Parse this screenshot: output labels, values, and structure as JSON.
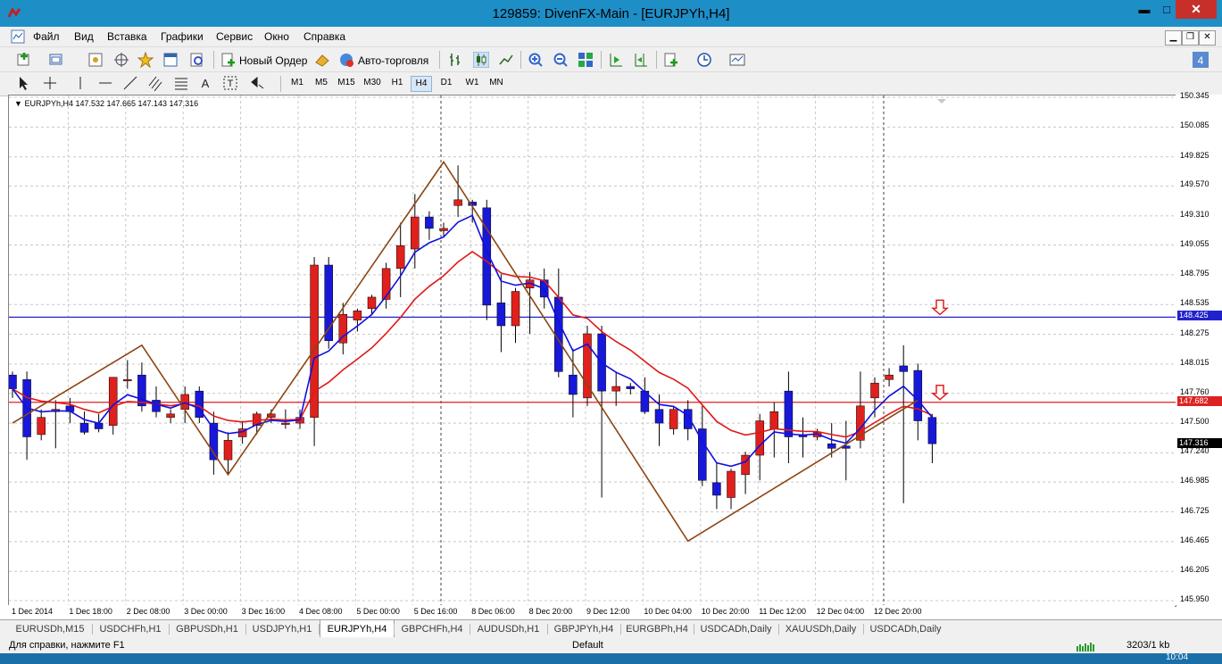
{
  "window": {
    "title": "129859: DivenFX-Main - [EURJPYh,H4]",
    "minimize": "▬",
    "maximize": "□",
    "close": "✕"
  },
  "menu": [
    "Файл",
    "Вид",
    "Вставка",
    "Графики",
    "Сервис",
    "Окно",
    "Справка"
  ],
  "toolbar": {
    "new_order": "Новый Ордер",
    "auto_trading": "Авто-торговля",
    "search_placeholder": ""
  },
  "timeframes": [
    "M1",
    "M5",
    "M15",
    "M30",
    "H1",
    "H4",
    "D1",
    "W1",
    "MN"
  ],
  "active_timeframe": "H4",
  "chart": {
    "header": "EURJPYh,H4  147.532 147.665 147.143 147.316",
    "price_ticks": [
      "150.345",
      "150.085",
      "149.825",
      "149.570",
      "149.310",
      "149.055",
      "148.795",
      "148.535",
      "148.275",
      "148.015",
      "147.760",
      "147.500",
      "147.240",
      "146.985",
      "146.725",
      "146.465",
      "146.205",
      "145.950"
    ],
    "time_ticks": [
      "1 Dec 2014",
      "1 Dec 18:00",
      "2 Dec 08:00",
      "3 Dec 00:00",
      "3 Dec 16:00",
      "4 Dec 08:00",
      "5 Dec 00:00",
      "5 Dec 16:00",
      "8 Dec 06:00",
      "8 Dec 20:00",
      "9 Dec 12:00",
      "10 Dec 04:00",
      "10 Dec 20:00",
      "11 Dec 12:00",
      "12 Dec 04:00",
      "12 Dec 20:00"
    ],
    "blue_line_label": "148.425",
    "red_line_label": "147.682",
    "current_price_label": "147.316",
    "colors": {
      "bull": "#e0201c",
      "bear": "#1818d8",
      "zigzag": "#8b4513",
      "fast_ma": "#1010e0",
      "slow_ma": "#e01818"
    }
  },
  "chart_data": {
    "type": "candlestick",
    "symbol": "EURJPYh",
    "timeframe": "H4",
    "ylim": [
      145.95,
      150.345
    ],
    "hlines": [
      {
        "name": "blue",
        "value": 148.425
      },
      {
        "name": "red",
        "value": 147.682
      }
    ],
    "candles": [
      [
        147.92,
        147.95,
        147.72,
        147.8
      ],
      [
        147.88,
        147.95,
        147.18,
        147.38
      ],
      [
        147.4,
        147.62,
        147.35,
        147.55
      ],
      [
        147.6,
        147.7,
        147.28,
        147.62
      ],
      [
        147.65,
        147.72,
        147.5,
        147.6
      ],
      [
        147.5,
        147.6,
        147.4,
        147.42
      ],
      [
        147.5,
        147.58,
        147.42,
        147.45
      ],
      [
        147.48,
        147.65,
        147.4,
        147.9
      ],
      [
        147.88,
        148.05,
        147.8,
        147.88
      ],
      [
        147.92,
        148.03,
        147.6,
        147.65
      ],
      [
        147.7,
        147.82,
        147.55,
        147.6
      ],
      [
        147.55,
        147.62,
        147.5,
        147.58
      ],
      [
        147.62,
        147.82,
        147.5,
        147.75
      ],
      [
        147.78,
        147.82,
        147.5,
        147.55
      ],
      [
        147.5,
        147.6,
        147.05,
        147.18
      ],
      [
        147.18,
        147.42,
        147.05,
        147.35
      ],
      [
        147.38,
        147.52,
        147.32,
        147.45
      ],
      [
        147.48,
        147.6,
        147.4,
        147.58
      ],
      [
        147.55,
        147.62,
        147.5,
        147.58
      ],
      [
        147.5,
        147.62,
        147.45,
        147.5
      ],
      [
        147.5,
        147.62,
        147.45,
        147.55
      ],
      [
        147.55,
        148.95,
        147.3,
        148.88
      ],
      [
        148.88,
        148.95,
        148.15,
        148.22
      ],
      [
        148.2,
        148.55,
        148.1,
        148.45
      ],
      [
        148.4,
        148.5,
        148.3,
        148.48
      ],
      [
        148.5,
        148.62,
        148.45,
        148.6
      ],
      [
        148.58,
        148.9,
        148.5,
        148.85
      ],
      [
        148.85,
        149.25,
        148.6,
        149.05
      ],
      [
        149.02,
        149.5,
        148.85,
        149.3
      ],
      [
        149.3,
        149.35,
        149.1,
        149.2
      ],
      [
        149.18,
        149.25,
        149.12,
        149.2
      ],
      [
        149.4,
        149.75,
        149.3,
        149.45
      ],
      [
        149.43,
        149.45,
        149.25,
        149.4
      ],
      [
        149.38,
        149.45,
        148.4,
        148.53
      ],
      [
        148.55,
        148.8,
        148.12,
        148.35
      ],
      [
        148.35,
        148.68,
        148.2,
        148.65
      ],
      [
        148.68,
        148.82,
        148.28,
        148.75
      ],
      [
        148.75,
        148.85,
        148.5,
        148.6
      ],
      [
        148.6,
        148.85,
        147.9,
        147.95
      ],
      [
        147.92,
        148.15,
        147.55,
        147.75
      ],
      [
        147.72,
        148.35,
        147.65,
        148.28
      ],
      [
        148.28,
        148.35,
        146.85,
        147.78
      ],
      [
        147.78,
        147.95,
        147.65,
        147.82
      ],
      [
        147.82,
        147.85,
        147.75,
        147.8
      ],
      [
        147.78,
        147.9,
        147.58,
        147.6
      ],
      [
        147.62,
        147.75,
        147.3,
        147.5
      ],
      [
        147.45,
        147.65,
        147.4,
        147.62
      ],
      [
        147.62,
        147.7,
        147.35,
        147.45
      ],
      [
        147.45,
        147.65,
        146.95,
        147.0
      ],
      [
        146.98,
        147.15,
        146.75,
        146.87
      ],
      [
        146.85,
        147.1,
        146.75,
        147.08
      ],
      [
        147.05,
        147.25,
        146.88,
        147.22
      ],
      [
        147.22,
        147.58,
        147.0,
        147.52
      ],
      [
        147.45,
        147.68,
        147.2,
        147.6
      ],
      [
        147.78,
        147.95,
        147.15,
        147.38
      ],
      [
        147.4,
        147.55,
        147.2,
        147.38
      ],
      [
        147.38,
        147.45,
        147.35,
        147.42
      ],
      [
        147.32,
        147.5,
        147.2,
        147.28
      ],
      [
        147.3,
        147.52,
        147.0,
        147.28
      ],
      [
        147.35,
        147.95,
        147.28,
        147.65
      ],
      [
        147.72,
        147.9,
        147.55,
        147.85
      ],
      [
        147.88,
        147.98,
        147.82,
        147.92
      ],
      [
        148.0,
        148.18,
        146.8,
        147.95
      ],
      [
        147.96,
        148.02,
        147.35,
        147.52
      ],
      [
        147.55,
        147.58,
        147.15,
        147.32
      ]
    ]
  },
  "tabs": [
    "EURUSDh,M15",
    "USDCHFh,H1",
    "GBPUSDh,H1",
    "USDJPYh,H1",
    "EURJPYh,H4",
    "GBPCHFh,H4",
    "AUDUSDh,H1",
    "GBPJPYh,H4",
    "EURGBPh,H4",
    "USDCADh,Daily",
    "XAUUSDh,Daily",
    "USDCADh,Daily"
  ],
  "active_tab": "EURJPYh,H4",
  "status": {
    "help": "Для справки, нажмите F1",
    "profile": "Default",
    "traffic": "3203/1 kb",
    "clock": "10:04"
  }
}
